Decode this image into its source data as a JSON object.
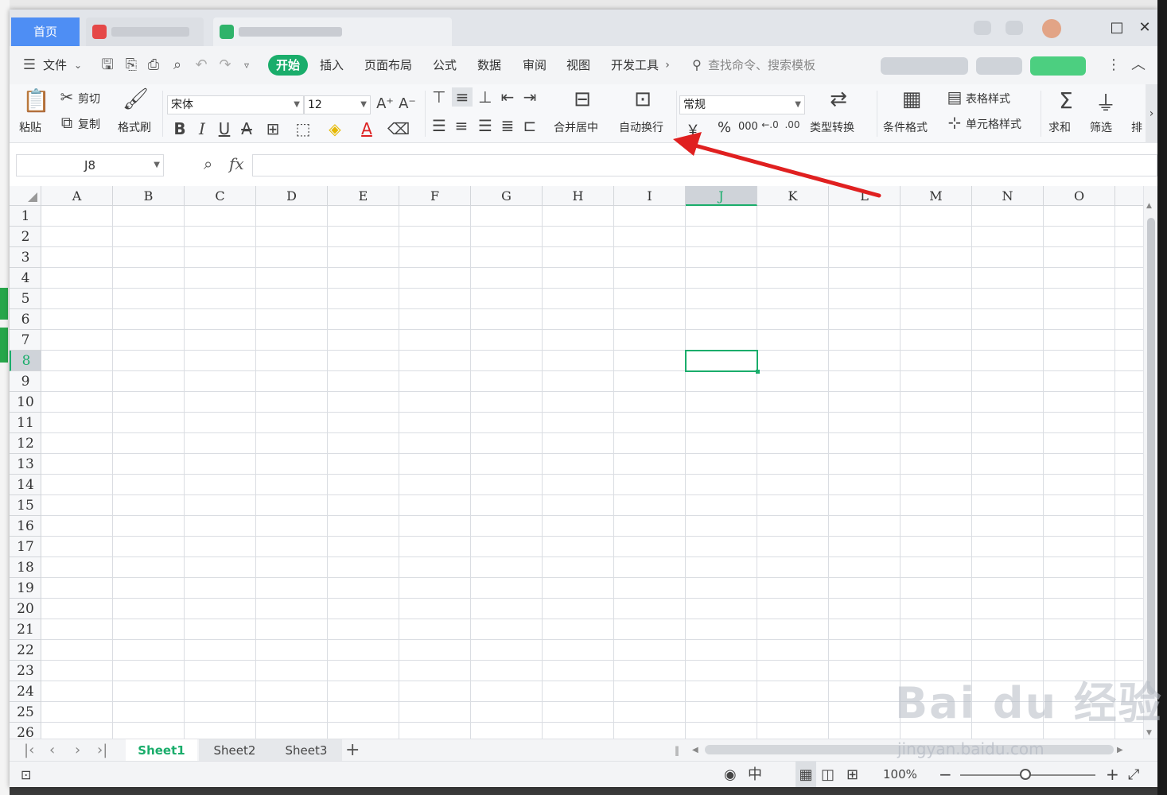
{
  "titlebar": {
    "home_tab": "首页",
    "controls": {
      "maximize": "□",
      "close": "✕"
    }
  },
  "menu": {
    "file": "文件",
    "tabs": [
      "开始",
      "插入",
      "页面布局",
      "公式",
      "数据",
      "审阅",
      "视图",
      "开发工具"
    ],
    "search_placeholder": "查找命令、搜索模板"
  },
  "ribbon": {
    "paste": "粘贴",
    "cut": "剪切",
    "copy": "复制",
    "format_painter": "格式刷",
    "font_name": "宋体",
    "font_size": "12",
    "merge_center": "合并居中",
    "wrap_text": "自动换行",
    "number_format": "常规",
    "currency": "￥",
    "percent": "%",
    "thousands": "000",
    "type_convert": "类型转换",
    "conditional_format": "条件格式",
    "table_style": "表格样式",
    "cell_style": "单元格样式",
    "sum": "求和",
    "filter": "筛选",
    "sort": "排"
  },
  "formula_bar": {
    "name_box": "J8",
    "fx": "fx",
    "formula": ""
  },
  "grid": {
    "columns": [
      "A",
      "B",
      "C",
      "D",
      "E",
      "F",
      "G",
      "H",
      "I",
      "J",
      "K",
      "L",
      "M",
      "N",
      "O"
    ],
    "rows": [
      "1",
      "2",
      "3",
      "4",
      "5",
      "6",
      "7",
      "8",
      "9",
      "10",
      "11",
      "12",
      "13",
      "14",
      "15",
      "16",
      "17",
      "18",
      "19",
      "20",
      "21",
      "22",
      "23",
      "24",
      "25",
      "26"
    ],
    "active_cell": "J8"
  },
  "sheets": {
    "tabs": [
      "Sheet1",
      "Sheet2",
      "Sheet3"
    ],
    "active": "Sheet1",
    "add": "+"
  },
  "status": {
    "zoom": "100%",
    "minus": "−",
    "plus": "+"
  },
  "watermark": {
    "brand": "Bai du 经验",
    "url": "jingyan.baidu.com"
  },
  "colors": {
    "accent": "#1aad6b",
    "home_tab": "#4e8ef4",
    "arrow": "#e02020"
  }
}
